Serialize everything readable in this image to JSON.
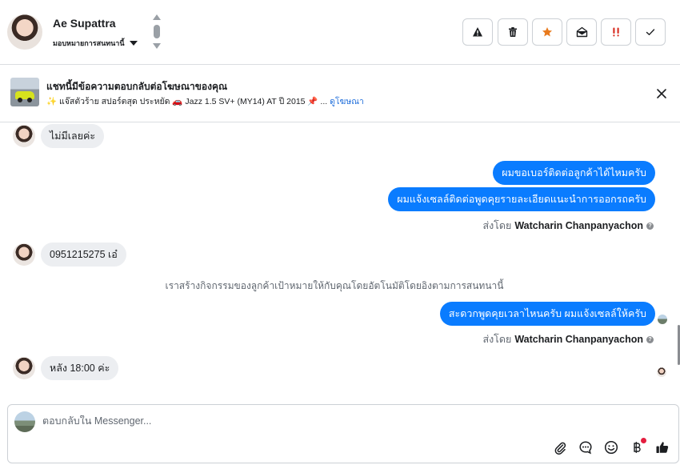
{
  "header": {
    "contact_name": "Ae Supattra",
    "assign_label": "มอบหมายการสนทนานี้",
    "actions": [
      {
        "name": "spam",
        "icon": "warning-icon"
      },
      {
        "name": "delete",
        "icon": "trash-icon"
      },
      {
        "name": "star",
        "icon": "star-icon",
        "color": "#e87a1d"
      },
      {
        "name": "mark-unread",
        "icon": "envelope-open-icon"
      },
      {
        "name": "follow-up",
        "icon": "exclamation-icon",
        "color": "#d93025"
      },
      {
        "name": "done",
        "icon": "checkmark-icon"
      }
    ]
  },
  "ad_banner": {
    "title": "แชทนี้มีข้อความตอบกลับต่อโฆษณาของคุณ",
    "subtitle": "✨ แจ๊สตัวร้าย สปอร์ตสุด ประหยัด 🚗 Jazz 1.5 SV+ (MY14) AT ปี 2015 📌 ...",
    "link": "ดูโฆษณา"
  },
  "messages": {
    "m1": "ไม่มีเลยค่ะ",
    "m2": "ผมขอเบอร์ติดต่อลูกค้าได้ไหมครับ",
    "m3": "ผมแจ้งเซลล์ติดต่อพูดคุยรายละเอียดแนะนำการออกรถครับ",
    "m4": "0951215275 เอ๋",
    "m5": "สะดวกพูดคุยเวลาไหนครับ ผมแจ้งเซลล์ให้ครับ",
    "m6": "หลัง 18:00 ค่ะ"
  },
  "sent_by": {
    "prefix": "ส่งโดย",
    "sender": "Watcharin Chanpanyachon"
  },
  "system_note": "เราสร้างกิจกรรมของลูกค้าเป้าหมายให้กับคุณโดยอัตโนมัติโดยอิงตามการสนทนานี้",
  "composer": {
    "placeholder": "ตอบกลับใน Messenger..."
  },
  "colors": {
    "outgoing_bubble": "#0a7cff",
    "incoming_bubble": "#eceef1",
    "link": "#216fdb"
  }
}
